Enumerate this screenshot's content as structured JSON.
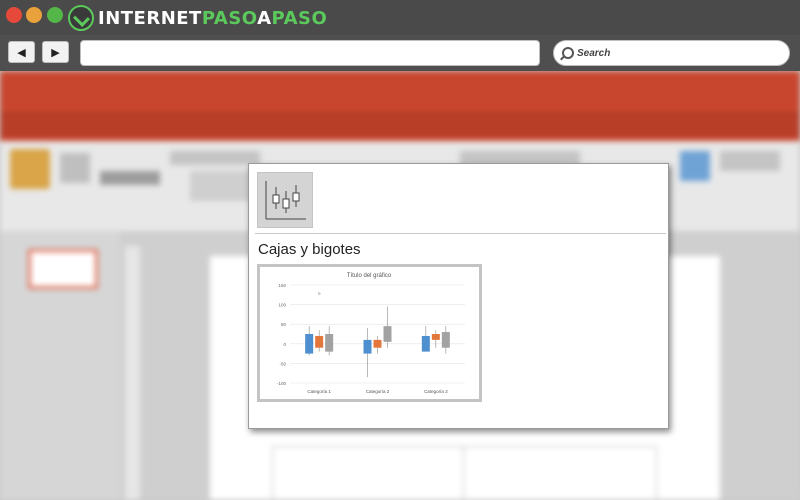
{
  "browser": {
    "logo_prefix": "INTERNET",
    "logo_mid": "PASO",
    "logo_a": "A",
    "logo_suffix": "PASO",
    "back_icon": "back-arrow-icon",
    "forward_icon": "forward-arrow-icon",
    "search_placeholder": "Search"
  },
  "colors": {
    "ribbon": "#c9462e",
    "series": [
      "#4e8fd0",
      "#e3773b",
      "#a2a2a2"
    ]
  },
  "popup": {
    "icon": "box-whisker-chart-icon",
    "title": "Cajas y bigotes"
  },
  "chart_data": {
    "type": "boxplot",
    "title": "Título del gráfico",
    "categories": [
      "Categoría 1",
      "Categoría 2",
      "Categoría 3"
    ],
    "yticks": [
      150,
      100,
      50,
      0,
      -50,
      -100
    ],
    "ylim": [
      -100,
      150
    ],
    "grid": true,
    "series": [
      {
        "boxes": [
          {
            "min": -30,
            "q1": -25,
            "q3": 25,
            "max": 45
          },
          {
            "min": -85,
            "q1": -25,
            "q3": 10,
            "max": 40
          },
          {
            "min": -15,
            "q1": -20,
            "q3": 20,
            "max": 45
          }
        ]
      },
      {
        "boxes": [
          {
            "min": -20,
            "q1": -10,
            "q3": 20,
            "max": 35
          },
          {
            "min": -25,
            "q1": -10,
            "q3": 10,
            "max": 20
          },
          {
            "min": -10,
            "q1": 10,
            "q3": 25,
            "max": 35
          }
        ]
      },
      {
        "boxes": [
          {
            "min": -30,
            "q1": -20,
            "q3": 25,
            "max": 45
          },
          {
            "min": -10,
            "q1": 5,
            "q3": 45,
            "max": 95
          },
          {
            "min": -25,
            "q1": -10,
            "q3": 30,
            "max": 45
          }
        ]
      }
    ],
    "outliers": [
      {
        "category": 0,
        "series": 1,
        "value": 128
      }
    ]
  }
}
